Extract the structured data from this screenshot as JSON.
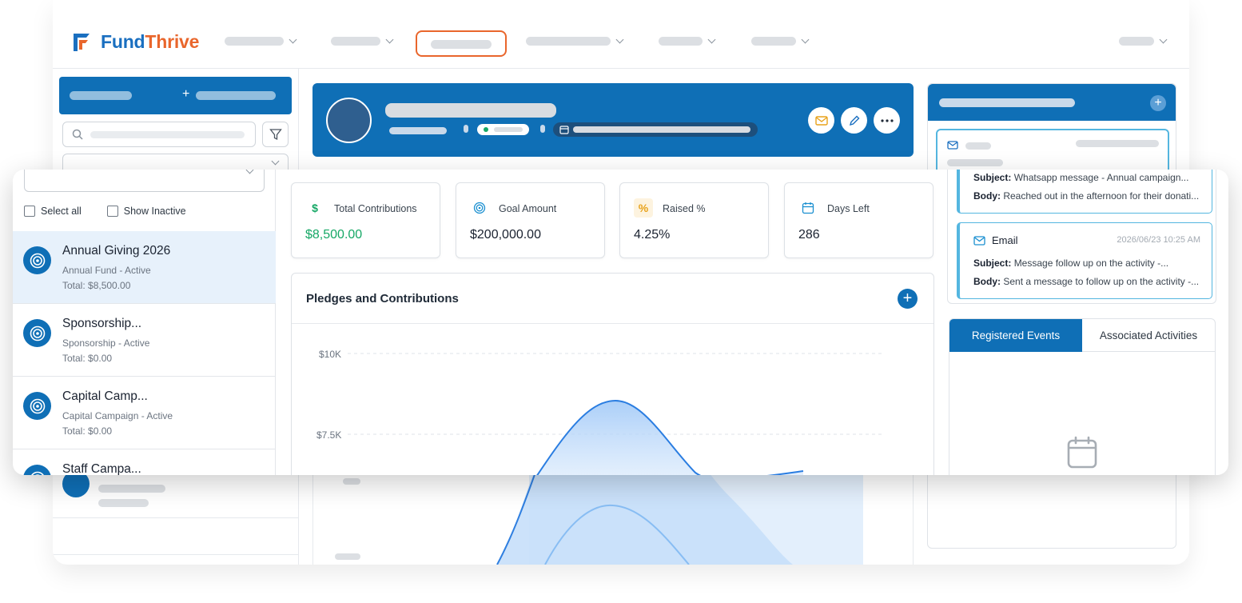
{
  "brand": {
    "name_part1": "Fund",
    "name_part2": "Thrive",
    "blue": "#1a6fc0",
    "orange": "#e9662c"
  },
  "colors": {
    "primary": "#0f6fb6",
    "success": "#16a866",
    "accent_border": "#54b6e0"
  },
  "campaign_list": {
    "select_all_label": "Select all",
    "show_inactive_label": "Show Inactive",
    "items": [
      {
        "title": "Annual Giving 2026",
        "subtitle": "Annual Fund - Active",
        "total": "Total: $8,500.00"
      },
      {
        "title": "Sponsorship...",
        "subtitle": "Sponsorship - Active",
        "total": "Total: $0.00"
      },
      {
        "title": "Capital Camp...",
        "subtitle": "Capital Campaign - Active",
        "total": "Total: $0.00"
      },
      {
        "title": "Staff Campa...",
        "subtitle": "",
        "total": ""
      }
    ]
  },
  "stats": [
    {
      "label": "Total Contributions",
      "value": "$8,500.00",
      "icon": "dollar-icon",
      "symbol": "$"
    },
    {
      "label": "Goal Amount",
      "value": "$200,000.00",
      "icon": "target-icon",
      "symbol": ""
    },
    {
      "label": "Raised %",
      "value": "4.25%",
      "icon": "percent-icon",
      "symbol": "%"
    },
    {
      "label": "Days Left",
      "value": "286",
      "icon": "calendar-icon",
      "symbol": ""
    }
  ],
  "pledges_chart": {
    "title": "Pledges and Contributions",
    "add_label": "+",
    "y_tick_labels": [
      "$10K",
      "$7.5K"
    ]
  },
  "chart_data": {
    "type": "area",
    "title": "Pledges and Contributions",
    "ylabel": "",
    "ylim": [
      0,
      10000
    ],
    "y_ticks": [
      "$10K",
      "$7.5K"
    ],
    "series": [
      {
        "points": [
          [
            0.0,
            0
          ],
          [
            0.25,
            6000
          ],
          [
            0.5,
            8500
          ],
          [
            0.75,
            4000
          ],
          [
            1.0,
            5000
          ]
        ]
      }
    ],
    "grid": true
  },
  "activities": [
    {
      "type": "",
      "date": "",
      "subject_label": "Subject:",
      "subject": "Whatsapp message - Annual campaign...",
      "body_label": "Body:",
      "body": "Reached out in the afternoon for their donati..."
    },
    {
      "type": "Email",
      "date": "2026/06/23 10:25 AM",
      "subject_label": "Subject:",
      "subject": "Message follow up on the activity -...",
      "body_label": "Body:",
      "body": "Sent a message to follow up on the activity -..."
    }
  ],
  "tabs": {
    "registered": "Registered Events",
    "associated": "Associated Activities"
  }
}
